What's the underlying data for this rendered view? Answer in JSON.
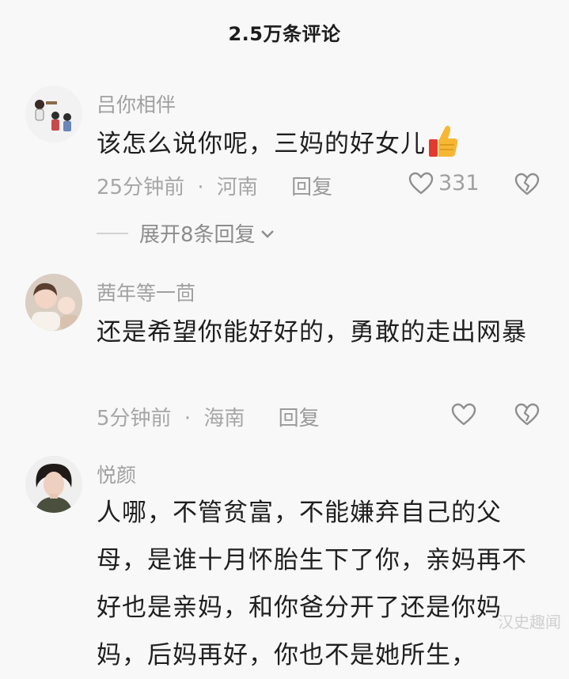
{
  "header": {
    "title": "2.5万条评论"
  },
  "comments": [
    {
      "author": "吕你相伴",
      "text": "该怎么说你呢，三妈的好女儿",
      "emoji": "thumbs-up",
      "time": "25分钟前",
      "location": "河南",
      "reply_label": "回复",
      "likes": "331",
      "expand_label": "展开8条回复"
    },
    {
      "author": "茜年等一茴",
      "text": "还是希望你能好好的，勇敢的走出网暴",
      "time": "5分钟前",
      "location": "海南",
      "reply_label": "回复"
    },
    {
      "author": "悦颜",
      "text": "人哪，不管贫富，不能嫌弃自己的父母，是谁十月怀胎生下了你，亲妈再不好也是亲妈，和你爸分开了还是你妈妈，后妈再好，你也不是她所生，"
    }
  ],
  "separator": "·",
  "watermark": "汉史趣闻",
  "icons": [
    "heart-icon",
    "broken-heart-icon",
    "chevron-down-icon",
    "thumbs-up-emoji"
  ]
}
